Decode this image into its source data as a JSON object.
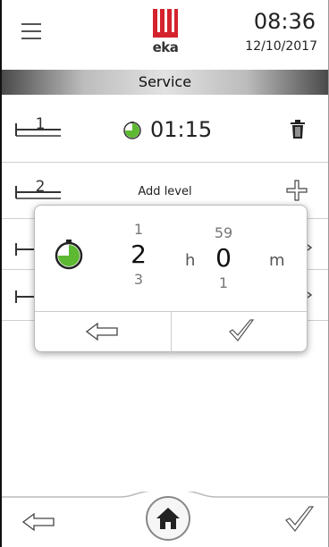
{
  "header": {
    "menu_icon": "hamburger-icon",
    "logo_text": "eka",
    "brand_color": "#d4232d",
    "time": "08:36",
    "date": "12/10/2017"
  },
  "title_bar": {
    "title": "Service"
  },
  "levels": [
    {
      "number": "1",
      "timer_icon": "timer-icon",
      "time": "01:15",
      "action_icon": "trash-icon"
    },
    {
      "number": "2",
      "label": "Add level",
      "action_icon": "plus-icon"
    }
  ],
  "time_picker": {
    "icon": "timer-icon",
    "hours": {
      "prev": "1",
      "current": "2",
      "next": "3",
      "unit": "h"
    },
    "minutes": {
      "prev": "59",
      "current": "0",
      "next": "1",
      "unit": "m"
    },
    "back_icon": "arrow-left-icon",
    "confirm_icon": "checkmark-icon"
  },
  "bottom_nav": {
    "back_icon": "arrow-left-icon",
    "home_icon": "home-icon",
    "confirm_icon": "checkmark-icon"
  },
  "colors": {
    "timer_green": "#5db832",
    "accent_red": "#d4232d"
  }
}
